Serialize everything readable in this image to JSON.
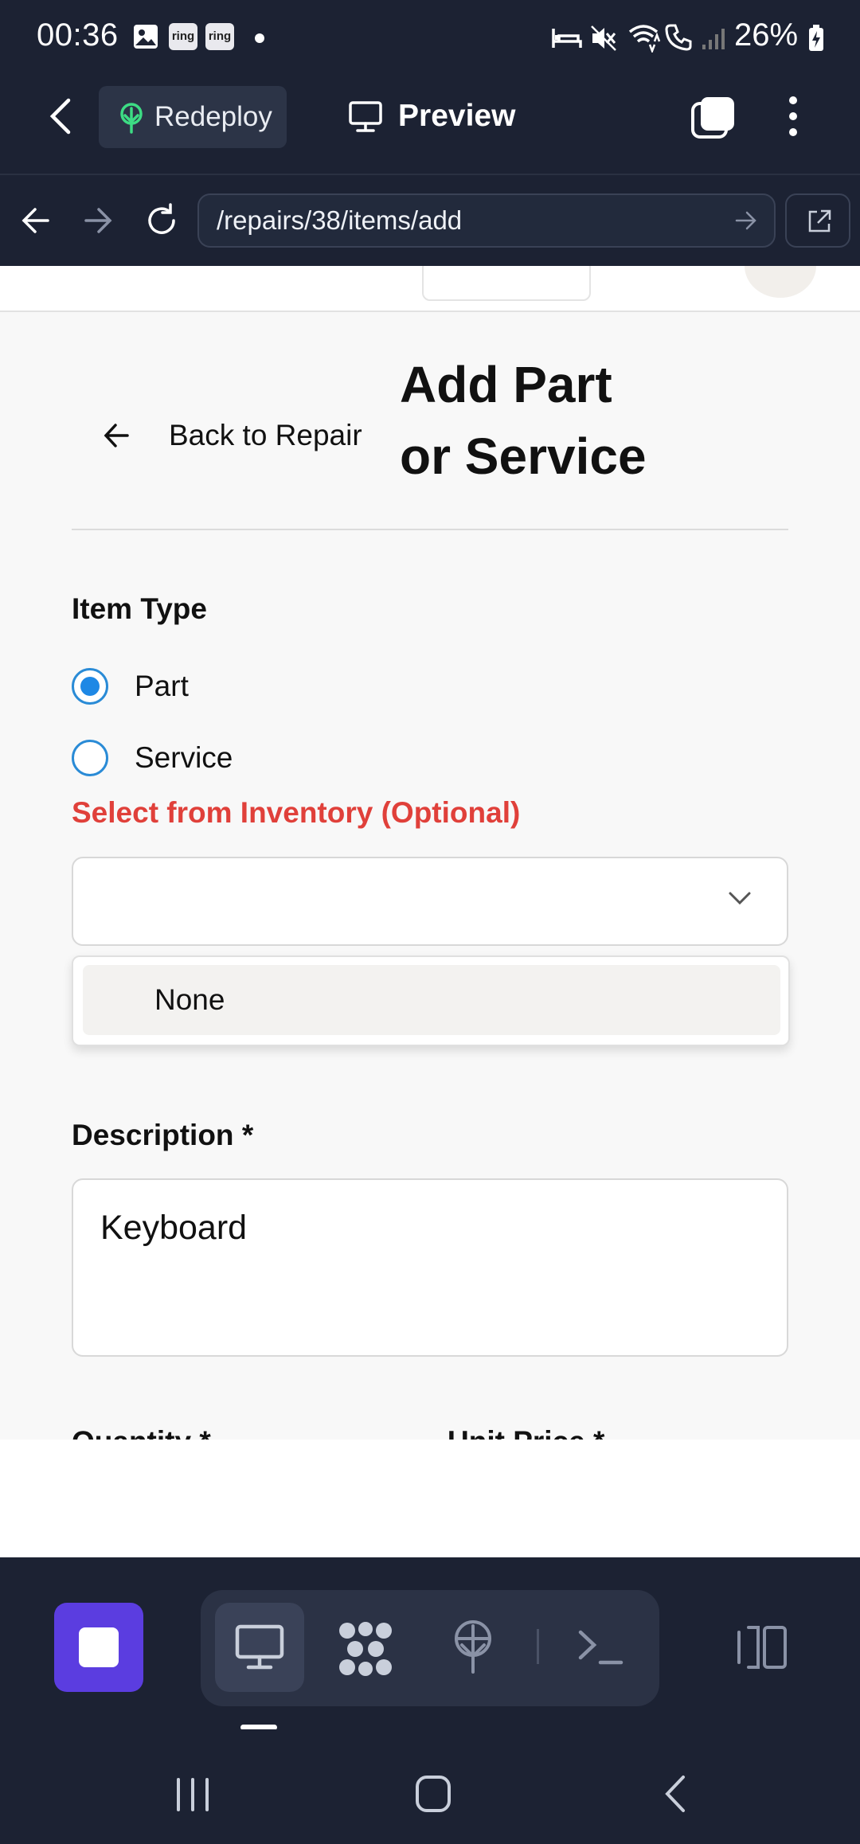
{
  "status_bar": {
    "time": "00:36",
    "ring_label_1": "ring",
    "ring_label_2": "ring",
    "battery": "26%"
  },
  "app_header": {
    "redeploy_label": "Redeploy",
    "preview_label": "Preview"
  },
  "browser": {
    "url": "/repairs/38/items/add"
  },
  "page": {
    "back_link": "Back to Repair",
    "title_line1": "Add Part",
    "title_line2": "or Service",
    "item_type_label": "Item Type",
    "item_type_options": [
      {
        "label": "Part",
        "selected": true
      },
      {
        "label": "Service",
        "selected": false
      }
    ],
    "inventory_label": "Select from Inventory (Optional)",
    "inventory_selected": "",
    "inventory_options": [
      "None"
    ],
    "description_label": "Description *",
    "description_value": "Keyboard",
    "quantity_label": "Quantity *",
    "unit_price_label": "Unit Price *"
  },
  "colors": {
    "app_bg": "#1c2233",
    "accent_purple": "#5b3de0",
    "radio_blue": "#1e88e5",
    "inventory_label_red": "#e0403a",
    "deploy_green": "#3ddc84"
  },
  "icons": {
    "header": [
      "chevron-left-icon",
      "tree-icon",
      "monitor-icon",
      "tabs-icon",
      "more-vertical-icon"
    ],
    "browser": [
      "arrow-left-icon",
      "arrow-right-icon",
      "reload-icon",
      "go-arrow-icon",
      "external-link-icon"
    ],
    "toolbar": [
      "stop-icon",
      "monitor-icon",
      "grid-icon",
      "antenna-icon",
      "terminal-icon",
      "split-panel-icon"
    ],
    "nav": [
      "recents-icon",
      "home-icon",
      "back-icon"
    ]
  }
}
